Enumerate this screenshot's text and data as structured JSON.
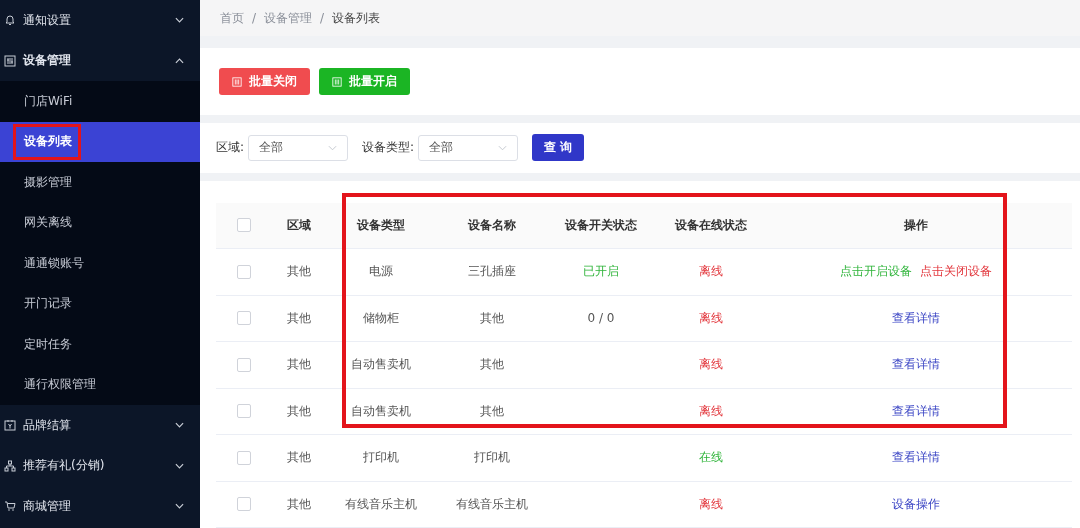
{
  "sidebar": {
    "groups": [
      {
        "label": "通知设置",
        "expanded": false
      },
      {
        "label": "设备管理",
        "expanded": true,
        "children": [
          {
            "label": "门店WiFi",
            "selected": false
          },
          {
            "label": "设备列表",
            "selected": true
          },
          {
            "label": "摄影管理",
            "selected": false
          },
          {
            "label": "网关离线",
            "selected": false
          },
          {
            "label": "通通锁账号",
            "selected": false
          },
          {
            "label": "开门记录",
            "selected": false
          },
          {
            "label": "定时任务",
            "selected": false
          },
          {
            "label": "通行权限管理",
            "selected": false
          }
        ]
      },
      {
        "label": "品牌结算",
        "expanded": false
      },
      {
        "label": "推荐有礼(分销)",
        "expanded": false
      },
      {
        "label": "商城管理",
        "expanded": false
      }
    ]
  },
  "breadcrumb": {
    "items": [
      "首页",
      "设备管理",
      "设备列表"
    ],
    "separator": "/"
  },
  "batch_buttons": [
    {
      "label": "批量关闭",
      "kind": "close"
    },
    {
      "label": "批量开启",
      "kind": "open"
    }
  ],
  "filters": [
    {
      "label": "区域:",
      "value": "全部"
    },
    {
      "label": "设备类型:",
      "value": "全部"
    }
  ],
  "query_button": "查 询",
  "table": {
    "columns": [
      "区域",
      "设备类型",
      "设备名称",
      "设备开关状态",
      "设备在线状态",
      "操作"
    ],
    "header_checked": false,
    "rows": [
      {
        "checked": false,
        "area": "其他",
        "type": "电源",
        "name": "三孔插座",
        "switch": {
          "text": "已开启",
          "kind": "on"
        },
        "online": {
          "text": "离线",
          "on": false
        },
        "actions": [
          {
            "label": "点击开启设备",
            "kind": "open"
          },
          {
            "label": "点击关闭设备",
            "kind": "close"
          }
        ]
      },
      {
        "checked": false,
        "area": "其他",
        "type": "储物柜",
        "name": "其他",
        "switch": {
          "text": "0 / 0",
          "kind": "plain"
        },
        "online": {
          "text": "离线",
          "on": false
        },
        "actions": [
          {
            "label": "查看详情",
            "kind": "link"
          }
        ]
      },
      {
        "checked": false,
        "area": "其他",
        "type": "自动售卖机",
        "name": "其他",
        "online": {
          "text": "离线",
          "on": false
        },
        "actions": [
          {
            "label": "查看详情",
            "kind": "link"
          }
        ]
      },
      {
        "checked": false,
        "area": "其他",
        "type": "自动售卖机",
        "name": "其他",
        "online": {
          "text": "离线",
          "on": false
        },
        "actions": [
          {
            "label": "查看详情",
            "kind": "link"
          }
        ]
      },
      {
        "checked": false,
        "area": "其他",
        "type": "打印机",
        "name": "打印机",
        "online": {
          "text": "在线",
          "on": true
        },
        "actions": [
          {
            "label": "查看详情",
            "kind": "link"
          }
        ]
      },
      {
        "checked": false,
        "area": "其他",
        "type": "有线音乐主机",
        "name": "有线音乐主机",
        "online": {
          "text": "离线",
          "on": false
        },
        "actions": [
          {
            "label": "设备操作",
            "kind": "link"
          }
        ]
      }
    ]
  }
}
